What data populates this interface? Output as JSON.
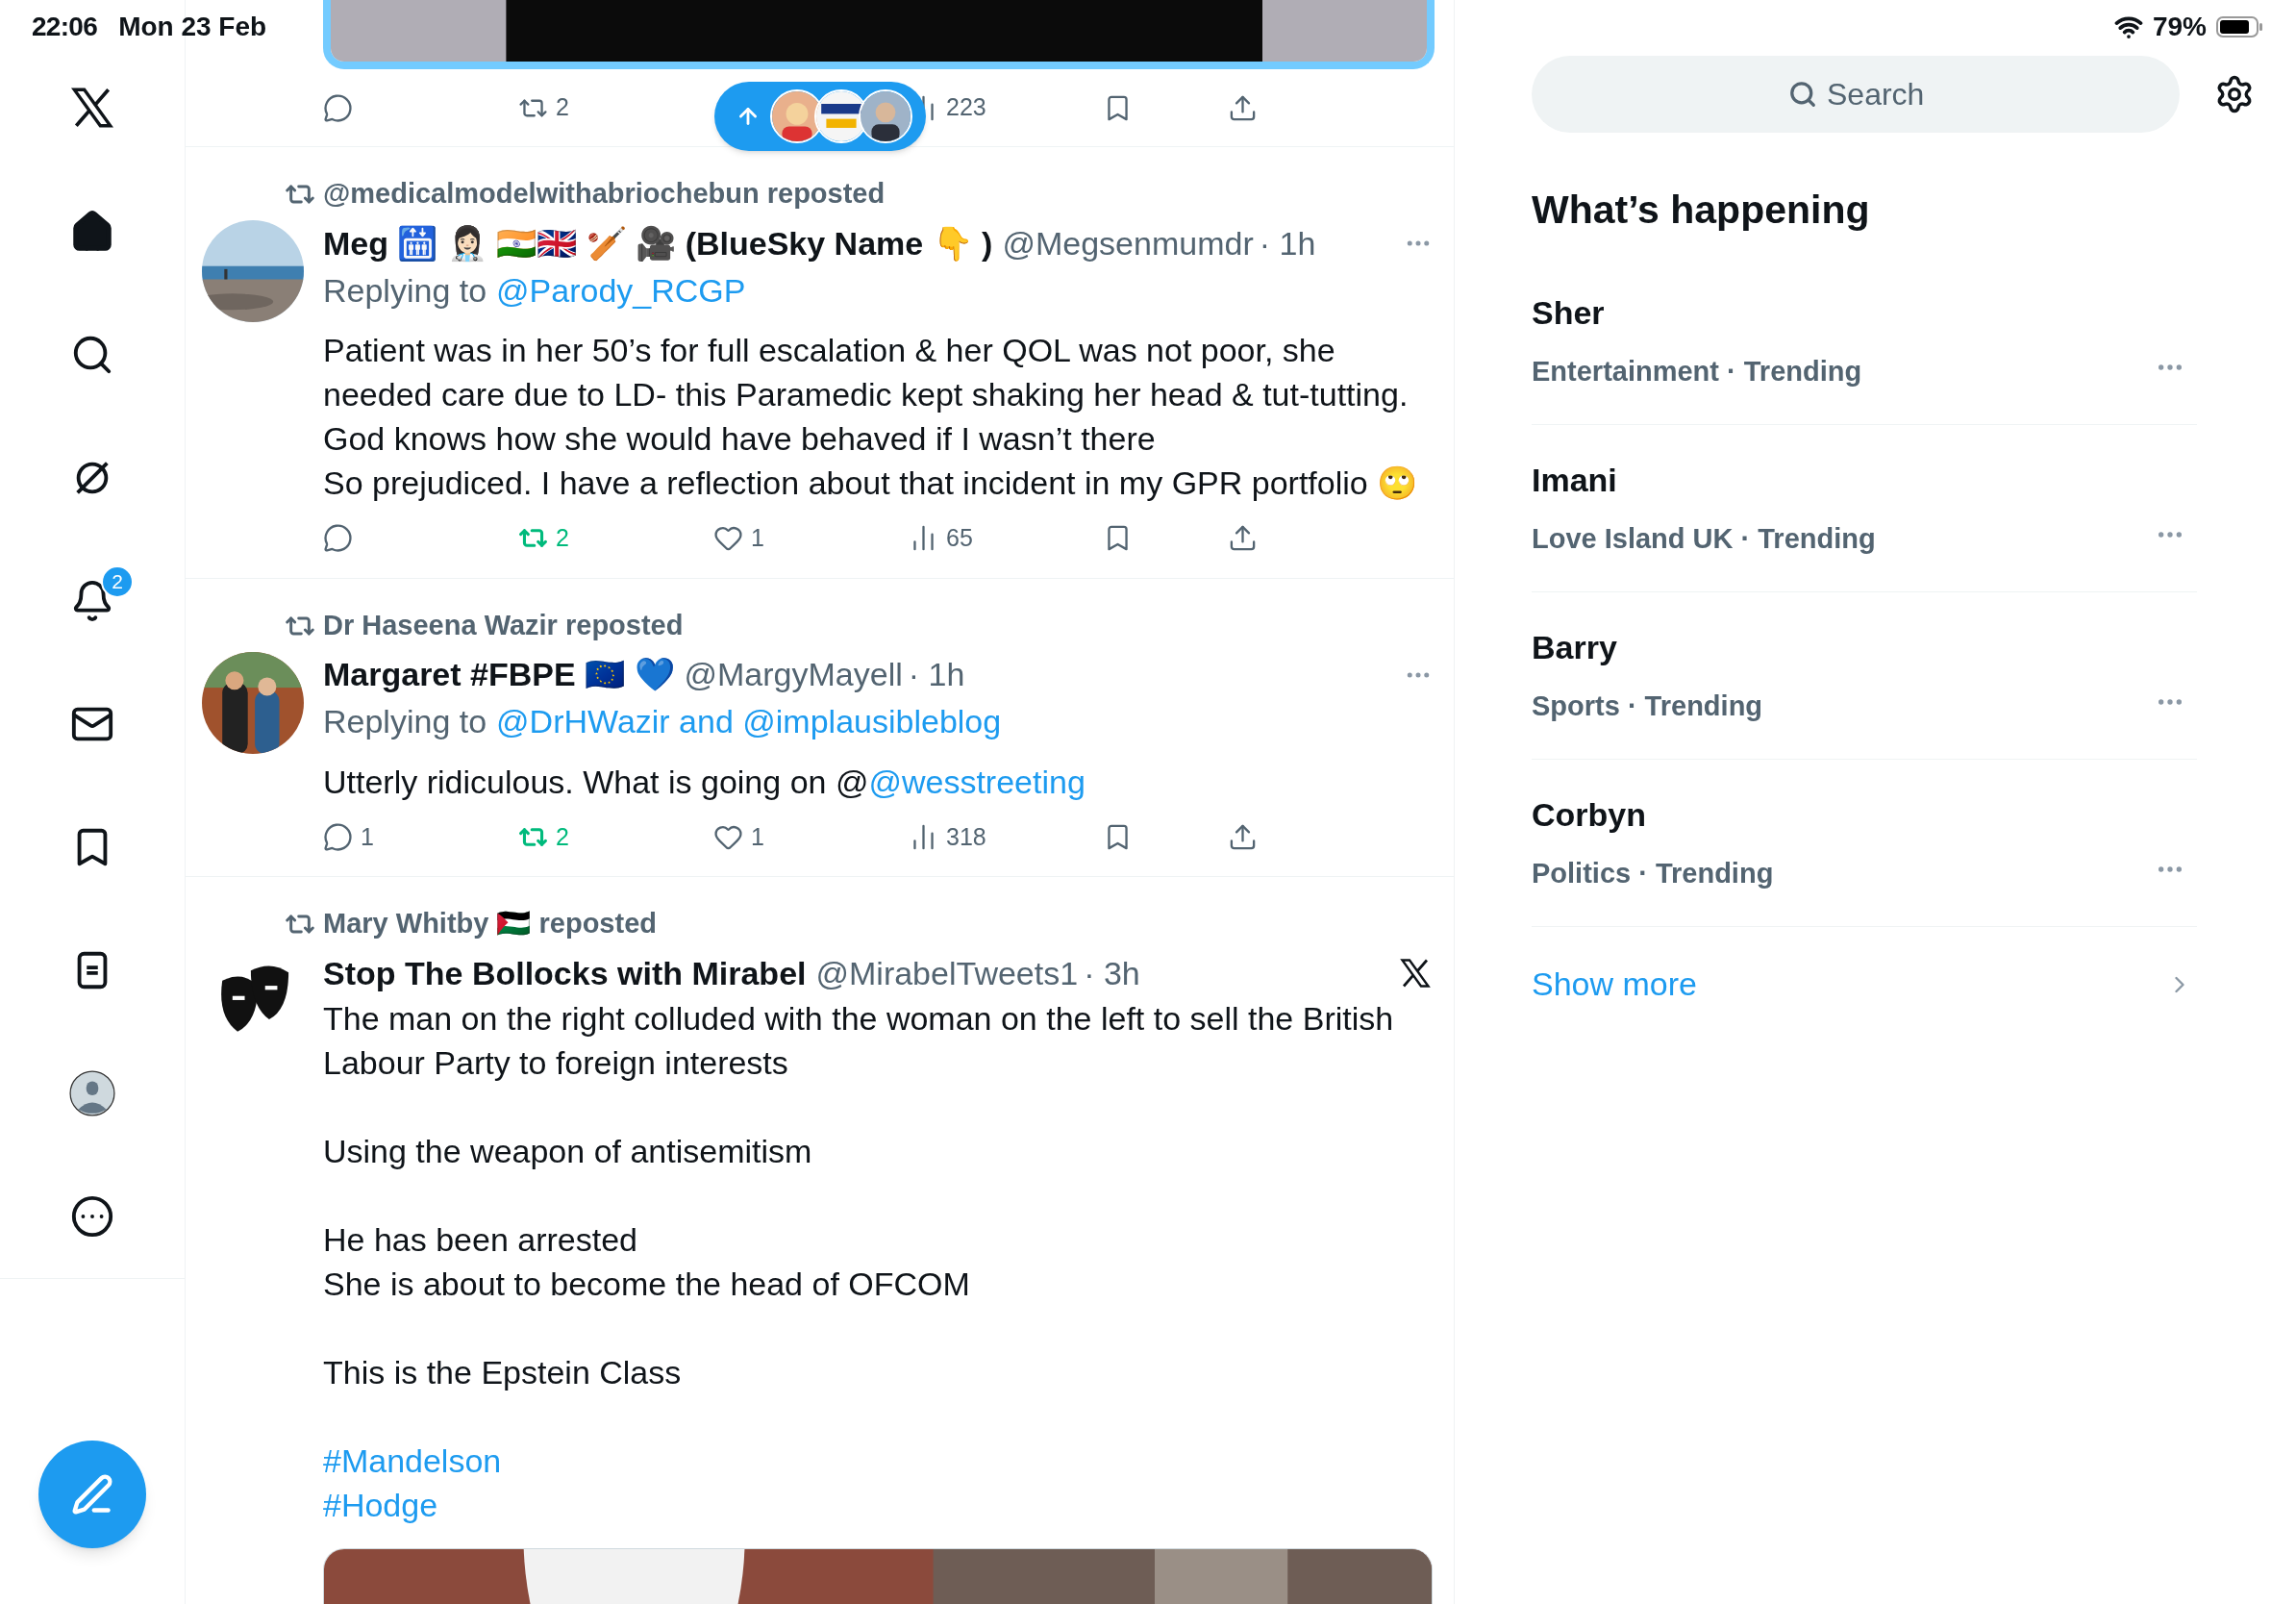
{
  "status_bar": {
    "time": "22:06",
    "date": "Mon 23 Feb",
    "battery": "79%"
  },
  "sidebar": {
    "nav": [
      {
        "kind": "home",
        "selected": true
      },
      {
        "kind": "search",
        "selected": false
      },
      {
        "kind": "grok",
        "selected": false
      },
      {
        "kind": "notifications",
        "selected": false,
        "badge": "2"
      },
      {
        "kind": "messages",
        "selected": false
      },
      {
        "kind": "bookmarks",
        "selected": false
      },
      {
        "kind": "lists",
        "selected": false
      },
      {
        "kind": "profile",
        "selected": false
      },
      {
        "kind": "more",
        "selected": false
      }
    ]
  },
  "feed": {
    "top_post": {
      "media": {
        "kind": "picture"
      },
      "actions": [
        {
          "kind": "reply"
        },
        {
          "kind": "retweet",
          "count": "2",
          "active": false
        },
        {
          "kind": "views",
          "count": "223"
        },
        {
          "kind": "bookmark"
        },
        {
          "kind": "share"
        }
      ]
    },
    "new_posts_pill": {
      "avatars": [
        {
          "kind": "picture"
        },
        {
          "kind": "picture"
        },
        {
          "kind": "picture"
        }
      ]
    },
    "posts": [
      {
        "reposted_by": "@medicalmodelwithabriochebun reposted",
        "avatar": {
          "kind": "picture"
        },
        "name": "Meg 🛗 👩🏻‍⚕️ 🇮🇳🇬🇧 🏏 🎥 (BlueSky Name 👇 )",
        "handle": "@Megsenmumdr",
        "time": "· 1h",
        "corner": {
          "kind": "more"
        },
        "reply_prefix": "Replying to",
        "reply_targets": "@Parody_RCGP",
        "paragraphs": [
          {
            "segments": [
              {
                "kind": "text",
                "text": "Patient was in her 50’s for full escalation & her QOL was not poor, she needed care due to LD- this Paramedic kept shaking her head & tut-tutting.\nGod knows how she would have behaved if I wasn’t there\nSo prejudiced. I have a reflection about that incident in my GPR portfolio 🙄"
              }
            ]
          }
        ],
        "actions": [
          {
            "kind": "reply"
          },
          {
            "kind": "retweet",
            "count": "2",
            "active": true
          },
          {
            "kind": "like",
            "count": "1"
          },
          {
            "kind": "views",
            "count": "65"
          },
          {
            "kind": "bookmark"
          },
          {
            "kind": "share"
          }
        ]
      },
      {
        "reposted_by": "Dr Haseena Wazir reposted",
        "avatar": {
          "kind": "picture"
        },
        "name": "Margaret #FBPE 🇪🇺 💙",
        "handle": "@MargyMayell",
        "time": "· 1h",
        "corner": {
          "kind": "more"
        },
        "reply_prefix": "Replying to",
        "reply_targets": "@DrHWazir and @implausibleblog",
        "paragraphs": [
          {
            "segments": [
              {
                "kind": "text",
                "text": "Utterly ridiculous. What is going on @"
              },
              {
                "kind": "link",
                "text": "@wesstreeting"
              }
            ]
          }
        ],
        "actions": [
          {
            "kind": "reply",
            "count": "1"
          },
          {
            "kind": "retweet",
            "count": "2",
            "active": true
          },
          {
            "kind": "like",
            "count": "1"
          },
          {
            "kind": "views",
            "count": "318"
          },
          {
            "kind": "bookmark"
          },
          {
            "kind": "share"
          }
        ]
      },
      {
        "reposted_by": "Mary Whitby 🇵🇸 reposted",
        "avatar": {
          "kind": "picture"
        },
        "name": "Stop The Bollocks with Mirabel",
        "handle": "@MirabelTweets1",
        "time": "· 3h",
        "corner": {
          "kind": "x"
        },
        "paragraphs": [
          {
            "segments": [
              {
                "kind": "text",
                "text": "The man on the right colluded with the woman on the left to sell the British Labour Party to foreign interests"
              }
            ]
          },
          {
            "segments": [
              {
                "kind": "text",
                "text": "Using the weapon of antisemitism"
              }
            ]
          },
          {
            "segments": [
              {
                "kind": "text",
                "text": "He has been arrested\nShe is about to become the head of OFCOM"
              }
            ]
          },
          {
            "segments": [
              {
                "kind": "text",
                "text": "This is the Epstein Class"
              }
            ]
          },
          {
            "segments": [
              {
                "kind": "link",
                "text": "#Mandelson\n#Hodge"
              }
            ]
          }
        ],
        "media": {
          "kind": "picture"
        }
      }
    ]
  },
  "right": {
    "search": {
      "placeholder": "Search"
    },
    "heading": "What’s happening",
    "trends": [
      {
        "title": "Sher",
        "meta": "Entertainment · Trending"
      },
      {
        "title": "Imani",
        "meta": "Love Island UK · Trending"
      },
      {
        "title": "Barry",
        "meta": "Sports · Trending"
      },
      {
        "title": "Corbyn",
        "meta": "Politics · Trending"
      }
    ],
    "show_more": "Show more"
  }
}
